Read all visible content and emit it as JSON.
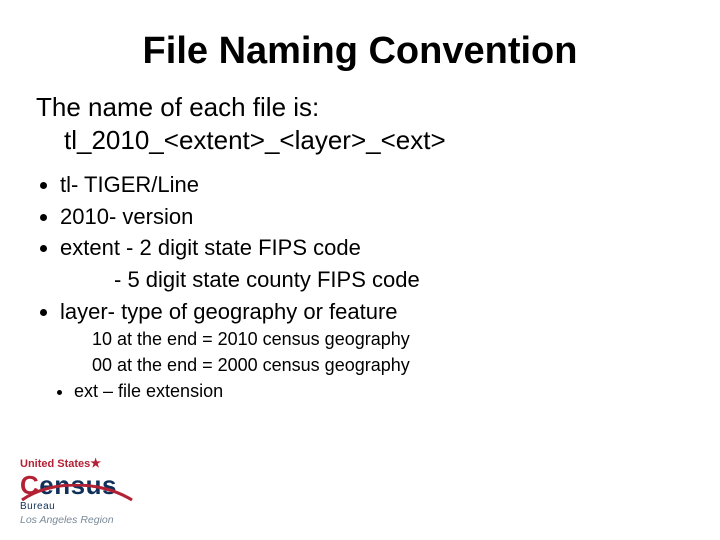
{
  "title": "File Naming Convention",
  "lead_line1": "The name of each file is:",
  "lead_line2": "tl_2010_<extent>_<layer>_<ext>",
  "bullets": {
    "b1": "tl- TIGER/Line",
    "b2": "2010- version",
    "b3": "extent  - 2 digit state FIPS code",
    "b3_sub": "- 5 digit state county FIPS code",
    "b4": "layer- type of geography or feature",
    "b4_note1": "10 at the end = 2010 census geography",
    "b4_note2": "00 at the end = 2000 census geography",
    "b5": "ext – file extension"
  },
  "logo": {
    "top": "United States",
    "word_c": "C",
    "word_rest": "ensus",
    "bureau": "Bureau",
    "region": "Los Angeles Region"
  }
}
